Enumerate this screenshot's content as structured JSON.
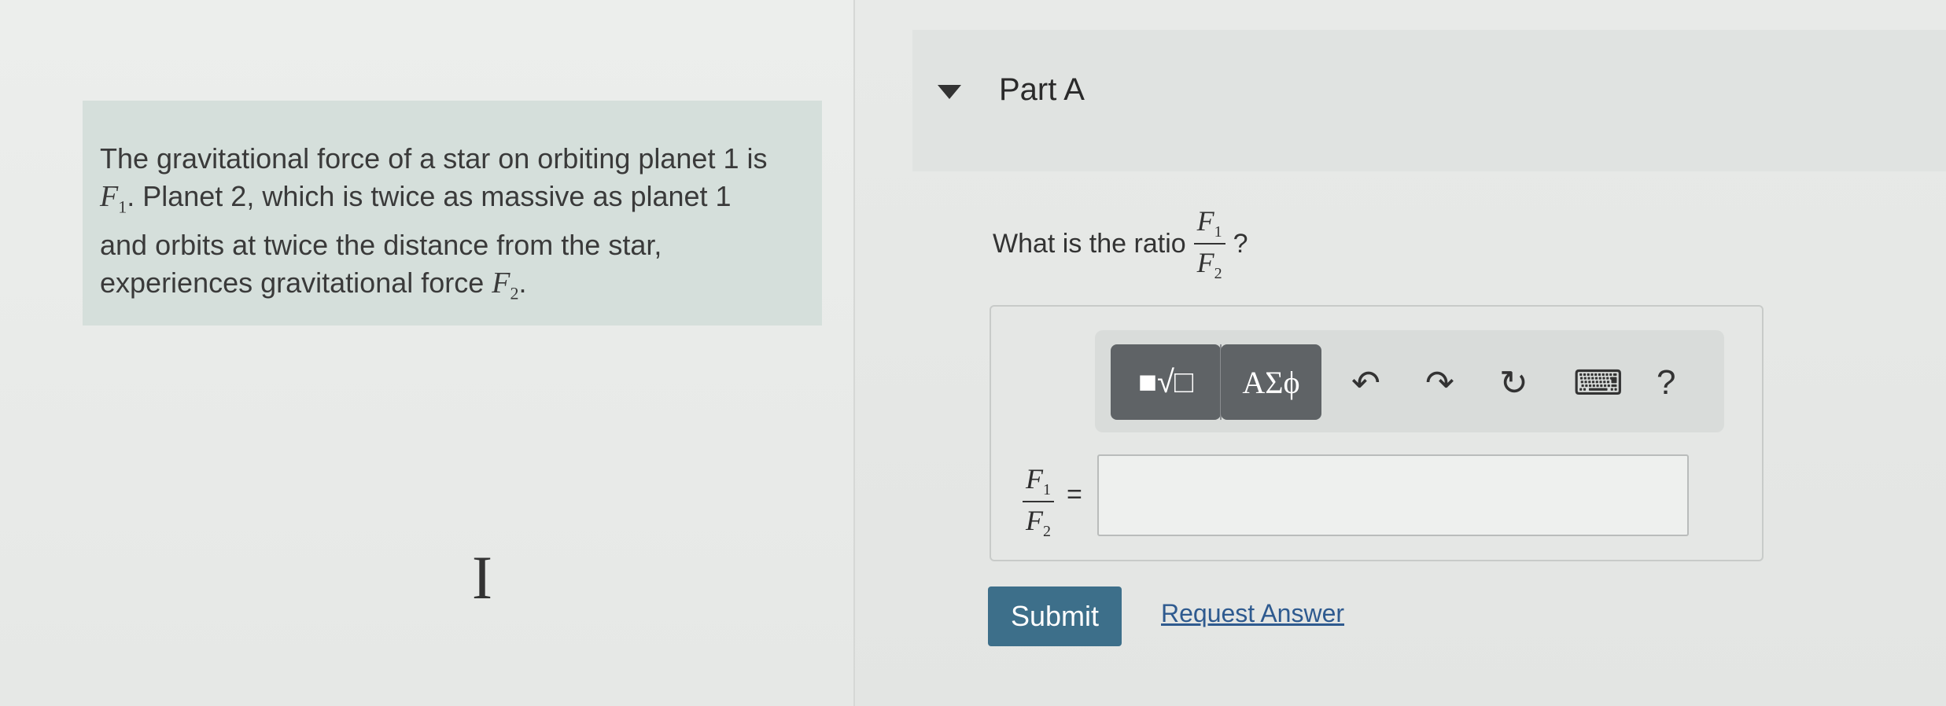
{
  "problem": {
    "line1": "The gravitational force of a star on orbiting planet 1 is",
    "f1_var": "F",
    "f1_sub": "1",
    "line2_rest": ". Planet 2, which is twice as massive as planet 1",
    "line3": "and orbits at twice the distance from the star,",
    "line4": "experiences gravitational force",
    "f2_var": "F",
    "f2_sub": "2",
    "line4_end": "."
  },
  "part": {
    "title": "Part A"
  },
  "question": {
    "prefix": "What is the ratio",
    "num_var": "F",
    "num_sub": "1",
    "den_var": "F",
    "den_sub": "2",
    "suffix": "?"
  },
  "toolbar": {
    "templates_icon": "■√□",
    "greek_label": "ΑΣϕ",
    "undo_icon": "↶",
    "redo_icon": "↷",
    "reset_icon": "↻",
    "keyboard_icon": "⌨",
    "help_icon": "?"
  },
  "answer": {
    "lhs_num_var": "F",
    "lhs_num_sub": "1",
    "lhs_den_var": "F",
    "lhs_den_sub": "2",
    "equals": "=",
    "value": ""
  },
  "actions": {
    "submit_label": "Submit",
    "request_label": "Request Answer"
  },
  "cursor_glyph": "I"
}
